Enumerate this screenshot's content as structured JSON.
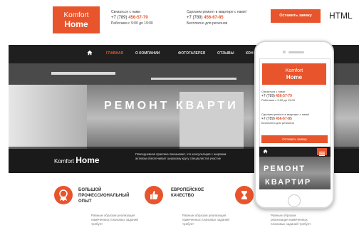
{
  "header": {
    "logo": {
      "line1": "Komfort",
      "line2": "Home"
    },
    "contact1": {
      "label": "Связаться с нами",
      "phone_prefix": "+7 (789)",
      "phone_number": "456-57-79",
      "hours": "Работаем с 9:00 до 19:00"
    },
    "contact2": {
      "label": "Сделаем ремонт в квартире с нами!",
      "phone_prefix": "+7 (789)",
      "phone_number": "456-67-85",
      "note": "Бесплатно для регионов"
    },
    "call_button": "Оставить заявку",
    "html_tag": "HTML"
  },
  "nav": {
    "items": [
      "ГЛАВНАЯ",
      "О КОМПАНИИ",
      "ФОТОГАЛЕРЕЯ",
      "ОТЗЫВЫ",
      "КОН"
    ],
    "active_color": "#e8542c"
  },
  "hero": {
    "title": "РЕМОНТ КВАРТИ",
    "brand_light": "Komfort",
    "brand_bold": "Home",
    "text": "Повседневная практика показывает, что консультация с широким активом обеспечивает широкому кругу специалистов участие"
  },
  "features": [
    {
      "title": "БОЛЬШОЙ ПРОФЕССИОНАЛЬНЫЙ ОПЫТ",
      "text": "Равным образом реализация намеченных плановых заданий требует",
      "icon": "award-icon"
    },
    {
      "title": "ЕВРОПЕЙСКОЕ КАЧЕСТВО",
      "text": "Равным образом реализация намеченных плановых заданий требует",
      "icon": "thumbs-up-icon"
    },
    {
      "title": "",
      "text": "Равным образом реализация намеченных плановых заданий требует",
      "icon": "hourglass-icon"
    }
  ],
  "phone": {
    "logo": {
      "line1": "Komfort",
      "line2": "Home"
    },
    "contact1": {
      "label": "Связаться с нами",
      "phone_prefix": "+7 (789)",
      "phone_number": "456-57-79",
      "hours": "Работаем с 9:00 до 19:00"
    },
    "contact2": {
      "label": "Сделаем ремонт в квартире с нами!",
      "phone_prefix": "+7 (789)",
      "phone_number": "456-67-85",
      "note": "Бесплатно для регионов"
    },
    "button": "Оставить заявку",
    "hero_line1": "РЕМОНТ",
    "hero_line2": "КВАРТИР"
  },
  "colors": {
    "accent": "#e8542c",
    "nav_bg": "#1f1f1f"
  }
}
